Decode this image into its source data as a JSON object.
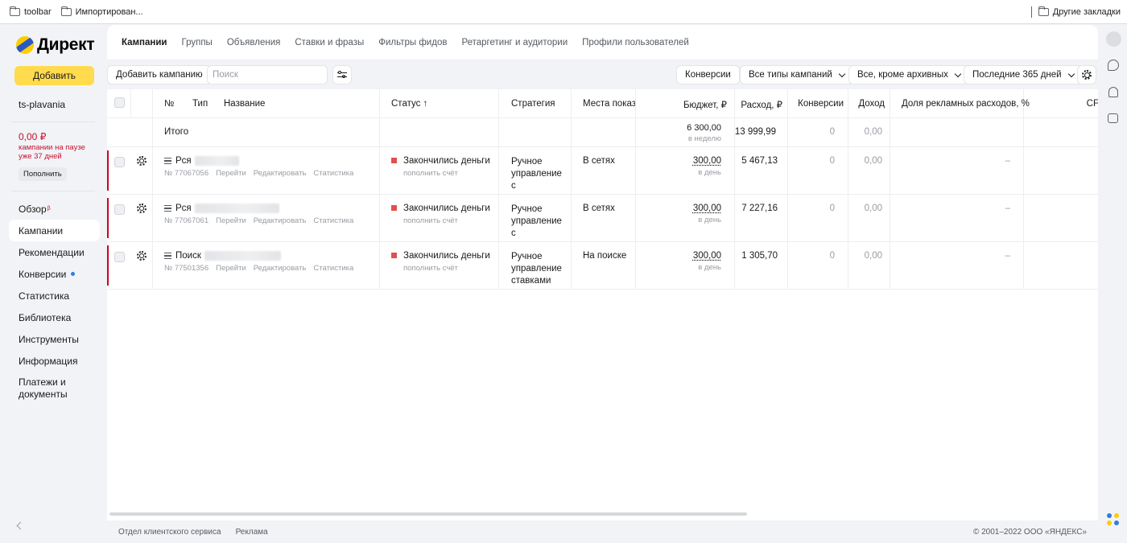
{
  "browser": {
    "bookmarks": [
      "toolbar",
      "Импортирован..."
    ],
    "other_bookmarks": "Другие закладки"
  },
  "sidebar": {
    "logo": "Директ",
    "add_label": "Добавить",
    "account": "ts-plavania",
    "balance": "0,00 ₽",
    "pause_note": "кампании на паузе уже 37 дней",
    "topup_label": "Пополнить",
    "nav": [
      {
        "label": "Обзор",
        "sup": "β"
      },
      {
        "label": "Кампании"
      },
      {
        "label": "Рекомендации"
      },
      {
        "label": "Конверсии"
      },
      {
        "label": "Статистика"
      },
      {
        "label": "Библиотека"
      },
      {
        "label": "Инструменты"
      },
      {
        "label": "Информация"
      },
      {
        "label": "Платежи и документы"
      }
    ]
  },
  "tabs": [
    "Кампании",
    "Группы",
    "Объявления",
    "Ставки и фразы",
    "Фильтры фидов",
    "Ретаргетинг и аудитории",
    "Профили пользователей"
  ],
  "toolbar": {
    "add_campaign": "Добавить кампанию",
    "search_placeholder": "Поиск",
    "conversions": "Конверсии",
    "campaign_types": "Все типы кампаний",
    "archive_filter": "Все, кроме архивных",
    "period": "Последние 365 дней"
  },
  "table": {
    "columns": {
      "num": "№",
      "type": "Тип",
      "name": "Название",
      "status": "Статус ↑",
      "strategy": "Стратегия",
      "places": "Места показ",
      "budget": "Бюджет, ₽",
      "spend": "Расход, ₽",
      "conversions": "Конверсии",
      "income": "Доход",
      "share": "Доля рекламных расходов, %",
      "cpa": "CF"
    },
    "total": {
      "label": "Итого",
      "budget": "6 300,00",
      "budget_sub": "в неделю",
      "spend": "13 999,99",
      "conversions": "0",
      "income": "0,00"
    },
    "rows": [
      {
        "type": "Рся",
        "number": "№ 77067056",
        "links": [
          "Перейти",
          "Редактировать",
          "Статистика"
        ],
        "status": "Закончились деньги",
        "status_sub": "пополнить счёт",
        "strategy": [
          "Ручное",
          "управление",
          "с"
        ],
        "places": "В сетях",
        "budget": "300,00",
        "budget_sub": "в день",
        "spend": "5 467,13",
        "conversions": "0",
        "income": "0,00",
        "share": "–"
      },
      {
        "type": "Рся",
        "number": "№ 77067061",
        "links": [
          "Перейти",
          "Редактировать",
          "Статистика"
        ],
        "status": "Закончились деньги",
        "status_sub": "пополнить счёт",
        "strategy": [
          "Ручное",
          "управление",
          "с"
        ],
        "places": "В сетях",
        "budget": "300,00",
        "budget_sub": "в день",
        "spend": "7 227,16",
        "conversions": "0",
        "income": "0,00",
        "share": "–"
      },
      {
        "type": "Поиск",
        "number": "№ 77501356",
        "links": [
          "Перейти",
          "Редактировать",
          "Статистика"
        ],
        "status": "Закончились деньги",
        "status_sub": "пополнить счёт",
        "strategy": [
          "Ручное",
          "управление",
          "ставками"
        ],
        "places": "На поиске",
        "budget": "300,00",
        "budget_sub": "в день",
        "spend": "1 305,70",
        "conversions": "0",
        "income": "0,00",
        "share": "–"
      }
    ]
  },
  "footer": {
    "links": [
      "Отдел клиентского сервиса",
      "Реклама"
    ],
    "copyright": "© 2001–2022 ООО «ЯНДЕКС»"
  },
  "colors": {
    "accent_yellow": "#ffdb4d",
    "alert_red": "#c8102e",
    "status_red": "#e05050"
  }
}
